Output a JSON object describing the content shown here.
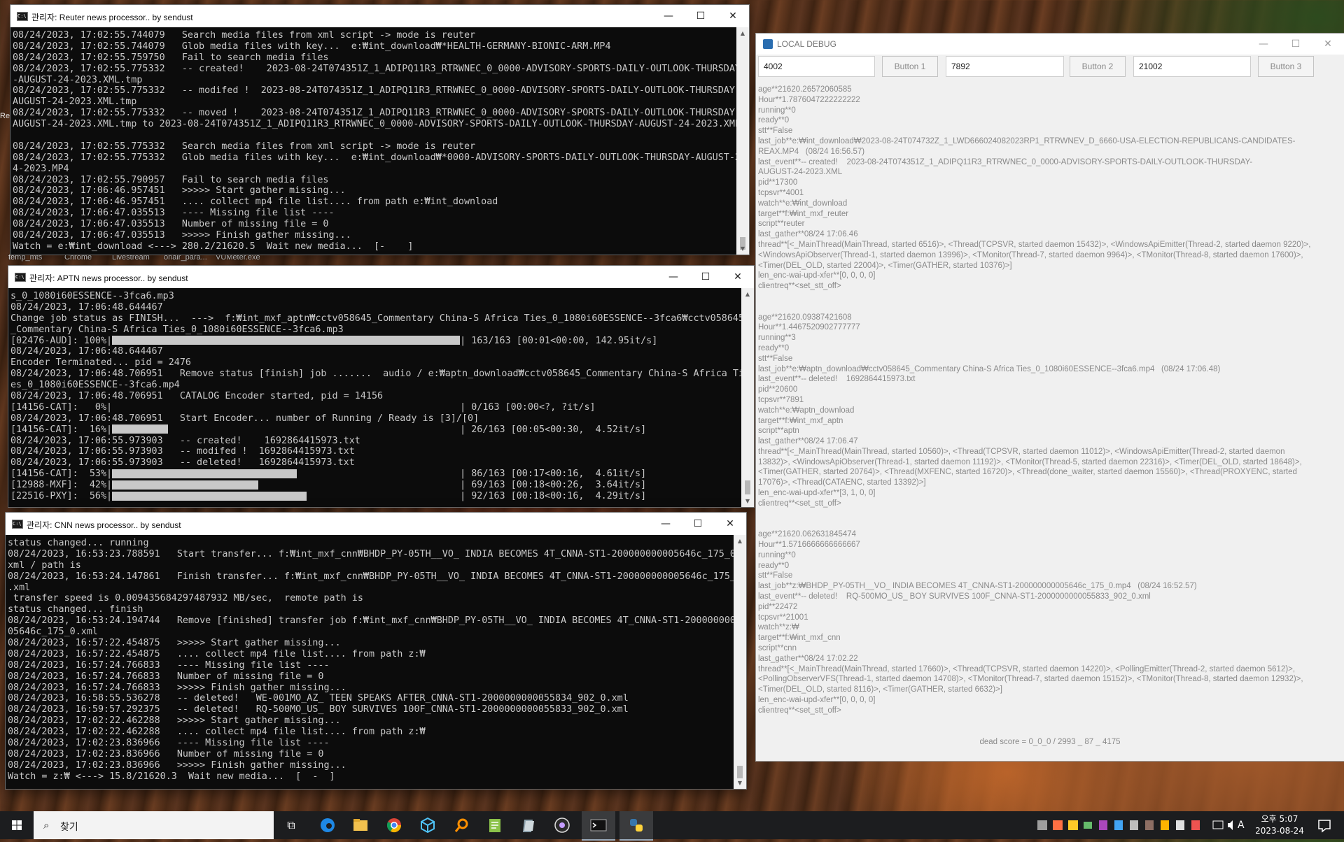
{
  "desktop": {
    "icons": [
      "temp_mts",
      "Chrome",
      "Livestream",
      "onair_para...",
      "VUMeter.exe"
    ],
    "left_clip": "Re"
  },
  "reuter_window": {
    "title": "관리자:  Reuter news processor.. by sendust",
    "lines": [
      "08/24/2023, 17:02:55.744079   Search media files from xml script -> mode is reuter",
      "08/24/2023, 17:02:55.744079   Glob media files with key...  e:₩int_download₩*HEALTH-GERMANY-BIONIC-ARM.MP4",
      "08/24/2023, 17:02:55.759750   Fail to search media files",
      "08/24/2023, 17:02:55.775332   -- created!    2023-08-24T074351Z_1_ADIPQ11R3_RTRWNEC_0_0000-ADVISORY-SPORTS-DAILY-OUTLOOK-THURSDAY",
      "-AUGUST-24-2023.XML.tmp",
      "08/24/2023, 17:02:55.775332   -- modifed !  2023-08-24T074351Z_1_ADIPQ11R3_RTRWNEC_0_0000-ADVISORY-SPORTS-DAILY-OUTLOOK-THURSDAY-",
      "AUGUST-24-2023.XML.tmp",
      "08/24/2023, 17:02:55.775332   -- moved !    2023-08-24T074351Z_1_ADIPQ11R3_RTRWNEC_0_0000-ADVISORY-SPORTS-DAILY-OUTLOOK-THURSDAY-",
      "AUGUST-24-2023.XML.tmp to 2023-08-24T074351Z_1_ADIPQ11R3_RTRWNEC_0_0000-ADVISORY-SPORTS-DAILY-OUTLOOK-THURSDAY-AUGUST-24-2023.XML",
      "",
      "08/24/2023, 17:02:55.775332   Search media files from xml script -> mode is reuter",
      "08/24/2023, 17:02:55.775332   Glob media files with key...  e:₩int_download₩*0000-ADVISORY-SPORTS-DAILY-OUTLOOK-THURSDAY-AUGUST-2",
      "4-2023.MP4",
      "08/24/2023, 17:02:55.790957   Fail to search media files",
      "08/24/2023, 17:06:46.957451   >>>>> Start gather missing...",
      "08/24/2023, 17:06:46.957451   .... collect mp4 file list.... from path e:₩int_download",
      "08/24/2023, 17:06:47.035513   ---- Missing file list ----",
      "08/24/2023, 17:06:47.035513   Number of missing file = 0",
      "08/24/2023, 17:06:47.035513   >>>>> Finish gather missing...",
      "Watch = e:₩int_download <---> 280.2/21620.5  Wait new media...  [-    ]"
    ]
  },
  "aptn_window": {
    "title": "관리자:  APTN news processor.. by sendust",
    "lines": [
      {
        "t": "s_0_1080i60ESSENCE--3fca6.mp3"
      },
      {
        "t": "08/24/2023, 17:06:48.644467"
      },
      {
        "t": "Change job status as FINISH...  --->  f:₩int_mxf_aptn₩cctv058645_Commentary China-S Africa Ties_0_1080i60ESSENCE--3fca6₩cctv058645"
      },
      {
        "t": "_Commentary China-S Africa Ties_0_1080i60ESSENCE--3fca6.mp3"
      },
      {
        "pre": "[02476-AUD]: 100%|",
        "fill": 1.0,
        "post": "| 163/163 [00:01<00:00, 142.95it/s]"
      },
      {
        "t": "08/24/2023, 17:06:48.644467"
      },
      {
        "t": "Encoder Terminated... pid = 2476"
      },
      {
        "t": "08/24/2023, 17:06:48.706951   Remove status [finish] job .......  audio / e:₩aptn_download₩cctv058645_Commentary China-S Africa Ti"
      },
      {
        "t": "es_0_1080i60ESSENCE--3fca6.mp4"
      },
      {
        "t": "08/24/2023, 17:06:48.706951   CATALOG Encoder started, pid = 14156"
      },
      {
        "pre": "[14156-CAT]:   0%|",
        "fill": 0.0,
        "post": "| 0/163 [00:00<?, ?it/s]"
      },
      {
        "t": "08/24/2023, 17:06:48.706951   Start Encoder... number of Running / Ready is [3]/[0]"
      },
      {
        "pre": "[14156-CAT]:  16%|",
        "fill": 0.16,
        "post": "| 26/163 [00:05<00:30,  4.52it/s]"
      },
      {
        "t": "08/24/2023, 17:06:55.973903   -- created!    1692864415973.txt"
      },
      {
        "t": "08/24/2023, 17:06:55.973903   -- modifed !  1692864415973.txt"
      },
      {
        "t": "08/24/2023, 17:06:55.973903   -- deleted!   1692864415973.txt"
      },
      {
        "pre": "[14156-CAT]:  53%|",
        "fill": 0.53,
        "post": "| 86/163 [00:17<00:16,  4.61it/s]"
      },
      {
        "pre": "[12988-MXF]:  42%|",
        "fill": 0.42,
        "post": "| 69/163 [00:18<00:26,  3.64it/s]"
      },
      {
        "pre": "[22516-PXY]:  56%|",
        "fill": 0.56,
        "post": "| 92/163 [00:18<00:16,  4.29it/s]"
      }
    ]
  },
  "cnn_window": {
    "title": "관리자:  CNN news processor.. by sendust",
    "lines": [
      "status changed... running",
      "08/24/2023, 16:53:23.788591   Start transfer... f:₩int_mxf_cnn₩BHDP_PY-05TH__VO_ INDIA BECOMES 4T_CNNA-ST1-200000000005646c_175_0.",
      "xml / path is",
      "08/24/2023, 16:53:24.147861   Finish transfer... f:₩int_mxf_cnn₩BHDP_PY-05TH__VO_ INDIA BECOMES 4T_CNNA-ST1-200000000005646c_175_0",
      ".xml",
      " transfer speed is 0.009435684297487932 MB/sec,  remote path is",
      "status changed... finish",
      "08/24/2023, 16:53:24.194744   Remove [finished] transfer job f:₩int_mxf_cnn₩BHDP_PY-05TH__VO_ INDIA BECOMES 4T_CNNA-ST1-2000000000",
      "05646c_175_0.xml",
      "08/24/2023, 16:57:22.454875   >>>>> Start gather missing...",
      "08/24/2023, 16:57:22.454875   .... collect mp4 file list.... from path z:₩",
      "08/24/2023, 16:57:24.766833   ---- Missing file list ----",
      "08/24/2023, 16:57:24.766833   Number of missing file = 0",
      "08/24/2023, 16:57:24.766833   >>>>> Finish gather missing...",
      "08/24/2023, 16:58:55.536278   -- deleted!   WE-001MO_AZ_ TEEN SPEAKS AFTER_CNNA-ST1-2000000000055834_902_0.xml",
      "08/24/2023, 16:59:57.292375   -- deleted!   RQ-500MO_US_ BOY SURVIVES 100F_CNNA-ST1-2000000000055833_902_0.xml",
      "08/24/2023, 17:02:22.462288   >>>>> Start gather missing...",
      "08/24/2023, 17:02:22.462288   .... collect mp4 file list.... from path z:₩",
      "08/24/2023, 17:02:23.836966   ---- Missing file list ----",
      "08/24/2023, 17:02:23.836966   Number of missing file = 0",
      "08/24/2023, 17:02:23.836966   >>>>> Finish gather missing...",
      "Watch = z:₩ <---> 15.8/21620.3  Wait new media...  [  -  ]"
    ]
  },
  "debug_window": {
    "title": "LOCAL DEBUG",
    "field1": "4002",
    "button1": "Button 1",
    "field2": "7892",
    "button2": "Button 2",
    "field3": "21002",
    "button3": "Button 3",
    "log_lines": [
      "age**21620.26572060585",
      "Hour**1.7876047222222222",
      "running**0",
      "ready**0",
      "stt**False",
      "last_job**e:₩int_download₩2023-08-24T074732Z_1_LWD666024082023RP1_RTRWNEV_D_6660-USA-ELECTION-REPUBLICANS-CANDIDATES-",
      "REAX.MP4   (08/24 16:56.57)",
      "last_event**-- created!    2023-08-24T074351Z_1_ADIPQ11R3_RTRWNEC_0_0000-ADVISORY-SPORTS-DAILY-OUTLOOK-THURSDAY-",
      "AUGUST-24-2023.XML",
      "pid**17300",
      "tcpsvr**4001",
      "watch**e:₩int_download",
      "target**f:₩int_mxf_reuter",
      "script**reuter",
      "last_gather**08/24 17:06.46",
      "thread**[<_MainThread(MainThread, started 6516)>, <Thread(TCPSVR, started daemon 15432)>, <WindowsApiEmitter(Thread-2, started daemon 9220)>,",
      "<WindowsApiObserver(Thread-1, started daemon 13996)>, <TMonitor(Thread-7, started daemon 9964)>, <TMonitor(Thread-8, started daemon 17600)>,",
      "<Timer(DEL_OLD, started 22004)>, <Timer(GATHER, started 10376)>]",
      "len_enc-wai-upd-xfer**[0, 0, 0, 0]",
      "clientreq**<set_stt_off>",
      "",
      "",
      "age**21620.09387421608",
      "Hour**1.4467520902777777",
      "running**3",
      "ready**0",
      "stt**False",
      "last_job**e:₩aptn_download₩cctv058645_Commentary China-S Africa Ties_0_1080i60ESSENCE--3fca6.mp4   (08/24 17:06.48)",
      "last_event**-- deleted!    1692864415973.txt",
      "pid**20600",
      "tcpsvr**7891",
      "watch**e:₩aptn_download",
      "target**f:₩int_mxf_aptn",
      "script**aptn",
      "last_gather**08/24 17:06.47",
      "thread**[<_MainThread(MainThread, started 10560)>, <Thread(TCPSVR, started daemon 11012)>, <WindowsApiEmitter(Thread-2, started daemon",
      "13832)>, <WindowsApiObserver(Thread-1, started daemon 11192)>, <TMonitor(Thread-5, started daemon 22316)>, <Timer(DEL_OLD, started 18648)>,",
      "<Timer(GATHER, started 20764)>, <Thread(MXFENC, started 16720)>, <Thread(done_waiter, started daemon 15560)>, <Thread(PROXYENC, started",
      "17076)>, <Thread(CATAENC, started 13392)>]",
      "len_enc-wai-upd-xfer**[3, 1, 0, 0]",
      "clientreq**<set_stt_off>",
      "",
      "",
      "age**21620.062631845474",
      "Hour**1.5716666666666667",
      "running**0",
      "ready**0",
      "stt**False",
      "last_job**z:₩BHDP_PY-05TH__VO_ INDIA BECOMES 4T_CNNA-ST1-200000000005646c_175_0.mp4   (08/24 16:52.57)",
      "last_event**-- deleted!    RQ-500MO_US_ BOY SURVIVES 100F_CNNA-ST1-2000000000055833_902_0.xml",
      "pid**22472",
      "tcpsvr**21001",
      "watch**z:₩",
      "target**f:₩int_mxf_cnn",
      "script**cnn",
      "last_gather**08/24 17:02.22",
      "thread**[<_MainThread(MainThread, started 17660)>, <Thread(TCPSVR, started daemon 14220)>, <PollingEmitter(Thread-2, started daemon 5612)>,",
      "<PollingObserverVFS(Thread-1, started daemon 14708)>, <TMonitor(Thread-7, started daemon 15152)>, <TMonitor(Thread-8, started daemon 12932)>,",
      "<Timer(DEL_OLD, started 8116)>, <Timer(GATHER, started 6632)>]",
      "len_enc-wai-upd-xfer**[0, 0, 0, 0]",
      "clientreq**<set_stt_off>"
    ],
    "dead_score": "dead score = 0_0_0 / 2993 _ 87 _ 4175"
  },
  "window_controls": {
    "minimize": "—",
    "maximize": "☐",
    "close": "✕"
  },
  "taskbar": {
    "search_placeholder": "찾기",
    "search_icon": "search-icon",
    "clock_ampm": "오후 5:07",
    "clock_date": "2023-08-24",
    "ime": "A",
    "apps": [
      "task-view",
      "edge",
      "file-explorer",
      "chrome",
      "3d-box",
      "search-tool",
      "notepad-plus",
      "file-tool",
      "obs",
      "terminal",
      "python"
    ]
  }
}
